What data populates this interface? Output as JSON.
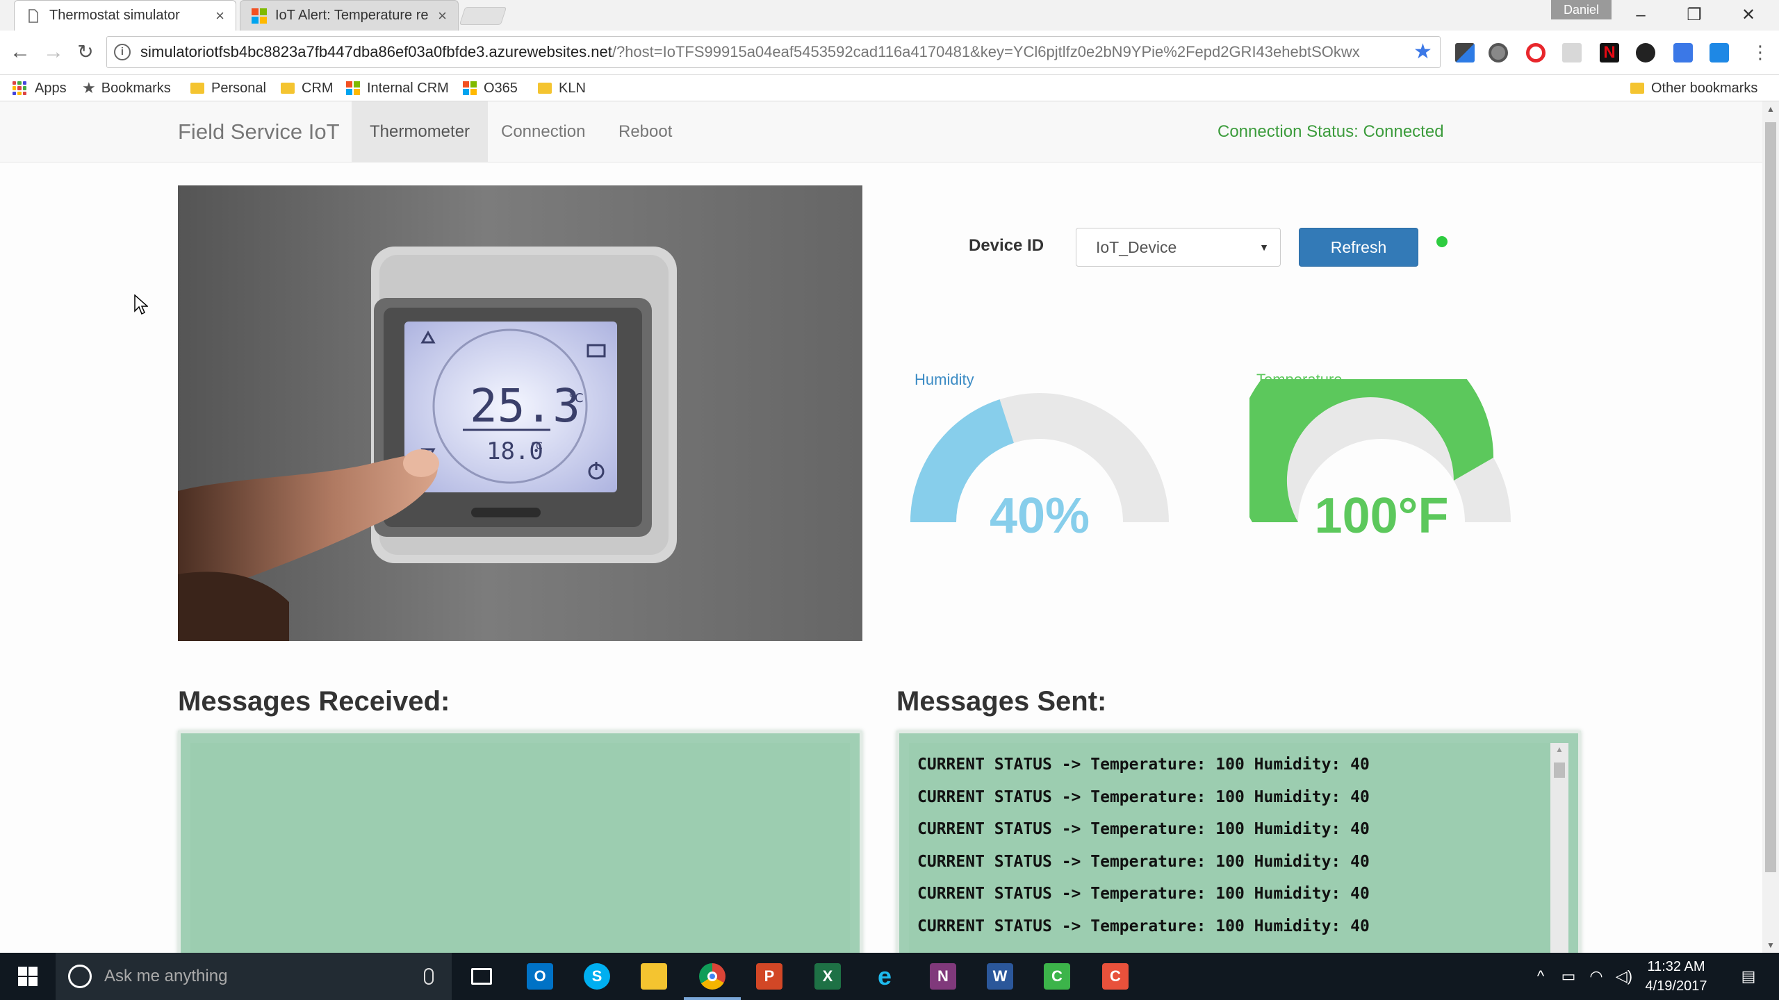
{
  "browser": {
    "tabs": [
      {
        "title": "Thermostat simulator",
        "close": "×"
      },
      {
        "title": "IoT Alert: Temperature re",
        "close": "×"
      }
    ],
    "user": "Daniel",
    "url_host": "simulatoriotfsb4bc8823a7fb447dba86ef03a0fbfde3.azurewebsites.net",
    "url_path": "/?host=IoTFS99915a04eaf5453592cad116a4170481&key=YCl6pjtlfz0e2bN9YPie%2Fepd2GRI43ehebtSOkwx",
    "bookmarks": [
      "Apps",
      "Bookmarks",
      "Personal",
      "CRM",
      "Internal CRM",
      "O365",
      "KLN"
    ],
    "other_bookmarks": "Other bookmarks"
  },
  "app": {
    "brand": "Field Service IoT",
    "nav": [
      "Thermometer",
      "Connection",
      "Reboot"
    ],
    "connection_status": "Connection Status: Connected",
    "device_label": "Device ID",
    "device_selected": "IoT_Device",
    "refresh_label": "Refresh",
    "status_color": "#2ecc40"
  },
  "thermostat_display": {
    "current": "25.3",
    "unit_current": "°C",
    "setpoint": "18.0",
    "unit_setpoint": "°C"
  },
  "gauges": {
    "humidity": {
      "label": "Humidity",
      "display": "40%",
      "value": 40,
      "min": 0,
      "max": 100,
      "color": "#87ceeb"
    },
    "temperature": {
      "label": "Temperature",
      "display": "100°F",
      "value": 100,
      "min": 0,
      "max": 120,
      "color": "#5cc85c"
    }
  },
  "messages": {
    "received_title": "Messages Received:",
    "received": [],
    "sent_title": "Messages Sent:",
    "sent": [
      "CURRENT STATUS -> Temperature: 100 Humidity: 40",
      "CURRENT STATUS -> Temperature: 100 Humidity: 40",
      "CURRENT STATUS -> Temperature: 100 Humidity: 40",
      "CURRENT STATUS -> Temperature: 100 Humidity: 40",
      "CURRENT STATUS -> Temperature: 100 Humidity: 40",
      "CURRENT STATUS -> Temperature: 100 Humidity: 40"
    ]
  },
  "taskbar": {
    "search_placeholder": "Ask me anything",
    "apps": [
      "Outlook",
      "Skype",
      "File Explorer",
      "Chrome",
      "PowerPoint",
      "Excel",
      "Internet Explorer",
      "OneNote",
      "Word",
      "Camtasia Recorder",
      "Camtasia"
    ],
    "time": "11:32 AM",
    "date": "4/19/2017"
  }
}
